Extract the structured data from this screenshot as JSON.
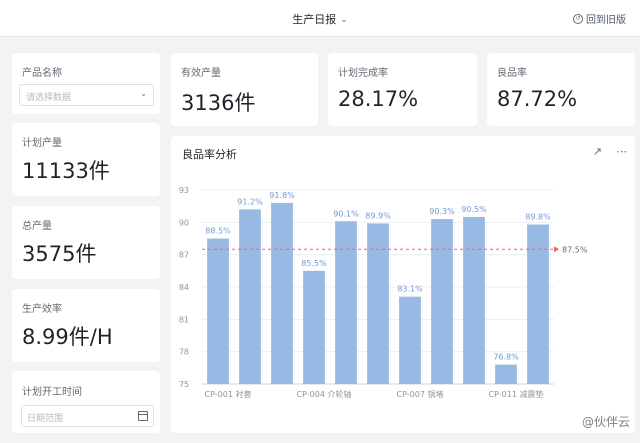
{
  "header": {
    "title": "生产日报",
    "back_label": "回到旧版"
  },
  "filters": {
    "product_name": {
      "label": "产品名称",
      "placeholder": "请选择数据"
    },
    "plan_start": {
      "label": "计划开工时间",
      "placeholder": "日期范围"
    }
  },
  "kpis": {
    "planned_output": {
      "label": "计划产量",
      "value": "11133件"
    },
    "total_output": {
      "label": "总产量",
      "value": "3575件"
    },
    "efficiency": {
      "label": "生产效率",
      "value": "8.99件/H"
    },
    "effective_output": {
      "label": "有效产量",
      "value": "3136件"
    },
    "plan_completion": {
      "label": "计划完成率",
      "value": "28.17%"
    },
    "yield_rate": {
      "label": "良品率",
      "value": "87.72%"
    }
  },
  "chart_panel": {
    "title": "良品率分析"
  },
  "chart_data": {
    "type": "bar",
    "categories": [
      "CP-001 衬套",
      "",
      "",
      "CP-004 介轮轴",
      "",
      "",
      "CP-007 锅堵",
      "",
      "",
      "CP-011 减震垫",
      ""
    ],
    "values": [
      88.5,
      91.2,
      91.8,
      85.5,
      90.1,
      89.9,
      83.1,
      90.3,
      90.5,
      76.8,
      89.8
    ],
    "data_labels": [
      "88.5%",
      "91.2%",
      "91.8%",
      "85.5%",
      "90.1%",
      "89.9%",
      "83.1%",
      "90.3%",
      "90.5%",
      "76.8%",
      "89.8%"
    ],
    "y_ticks": [
      "93",
      "90",
      "87",
      "84",
      "81",
      "78",
      "75"
    ],
    "ylim": [
      75,
      93
    ],
    "reference_line": {
      "value": 87.5,
      "label": "87.5%",
      "color": "#e8686b"
    },
    "bar_color": "#97b9e3",
    "label_color": "#6f9bd8",
    "grid": true
  },
  "watermark": "@伙伴云"
}
